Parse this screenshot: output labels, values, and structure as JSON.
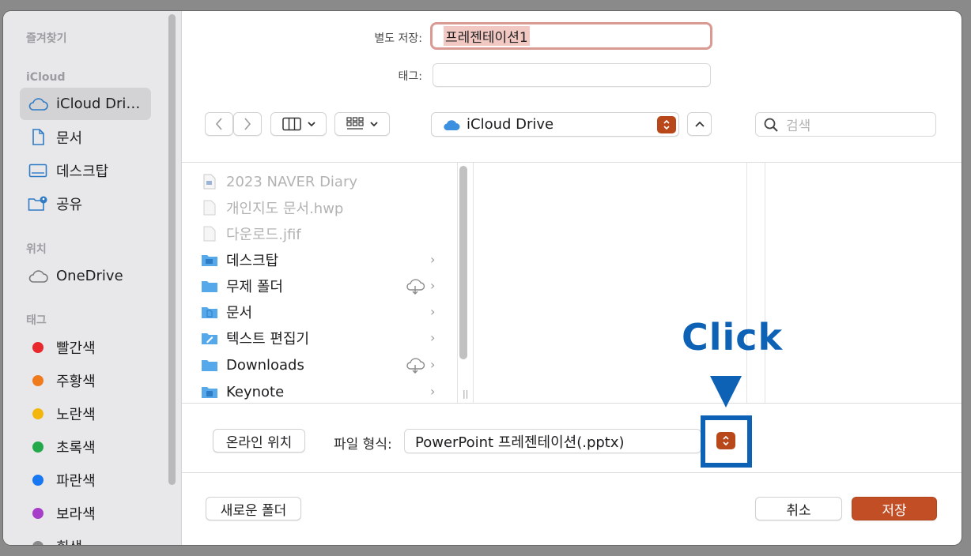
{
  "sidebar": {
    "favorites_header": "즐겨찾기",
    "icloud_header": "iCloud",
    "icloud_items": [
      {
        "label": "iCloud Dri…",
        "icon": "cloud-icon"
      },
      {
        "label": "문서",
        "icon": "document-icon"
      },
      {
        "label": "데스크탑",
        "icon": "desktop-icon"
      },
      {
        "label": "공유",
        "icon": "shared-folder-icon"
      }
    ],
    "locations_header": "위치",
    "location_items": [
      {
        "label": "OneDrive",
        "icon": "cloud-icon"
      }
    ],
    "tags_header": "태그",
    "tags": [
      {
        "label": "빨간색",
        "color": "#e8282b"
      },
      {
        "label": "주황색",
        "color": "#f07b1c"
      },
      {
        "label": "노란색",
        "color": "#f2b60d"
      },
      {
        "label": "초록색",
        "color": "#23a94a"
      },
      {
        "label": "파란색",
        "color": "#1877f2"
      },
      {
        "label": "보라색",
        "color": "#a73ec9"
      },
      {
        "label": "회색",
        "color": "#8a8a8a"
      }
    ]
  },
  "form": {
    "save_as_label": "별도 저장:",
    "save_as_value": "프레젠테이션1",
    "tags_label": "태그:",
    "tags_value": ""
  },
  "toolbar": {
    "location": "iCloud Drive",
    "search_placeholder": "검색"
  },
  "files": [
    {
      "name": "2023 NAVER Diary",
      "enabled": false,
      "type": "file"
    },
    {
      "name": "개인지도 문서.hwp",
      "enabled": false,
      "type": "file"
    },
    {
      "name": "다운로드.jfif",
      "enabled": false,
      "type": "file"
    },
    {
      "name": "데스크탑",
      "enabled": true,
      "type": "folder",
      "cloud": false
    },
    {
      "name": "무제 폴더",
      "enabled": true,
      "type": "folder",
      "cloud": true
    },
    {
      "name": "문서",
      "enabled": true,
      "type": "folder",
      "cloud": false
    },
    {
      "name": "텍스트 편집기",
      "enabled": true,
      "type": "folder",
      "cloud": false
    },
    {
      "name": "Downloads",
      "enabled": true,
      "type": "folder",
      "cloud": true
    },
    {
      "name": "Keynote",
      "enabled": true,
      "type": "folder",
      "cloud": false
    }
  ],
  "options": {
    "online_location_button": "온라인 위치",
    "file_format_label": "파일 형식:",
    "file_format_value": "PowerPoint 프레젠테이션(.pptx)"
  },
  "footer": {
    "new_folder_button": "새로운 폴더",
    "cancel_button": "취소",
    "save_button": "저장"
  },
  "annotation": {
    "text": "Click",
    "color": "#0d62b6"
  },
  "colors": {
    "accent": "#c14e24",
    "annotation": "#0d62b6"
  }
}
